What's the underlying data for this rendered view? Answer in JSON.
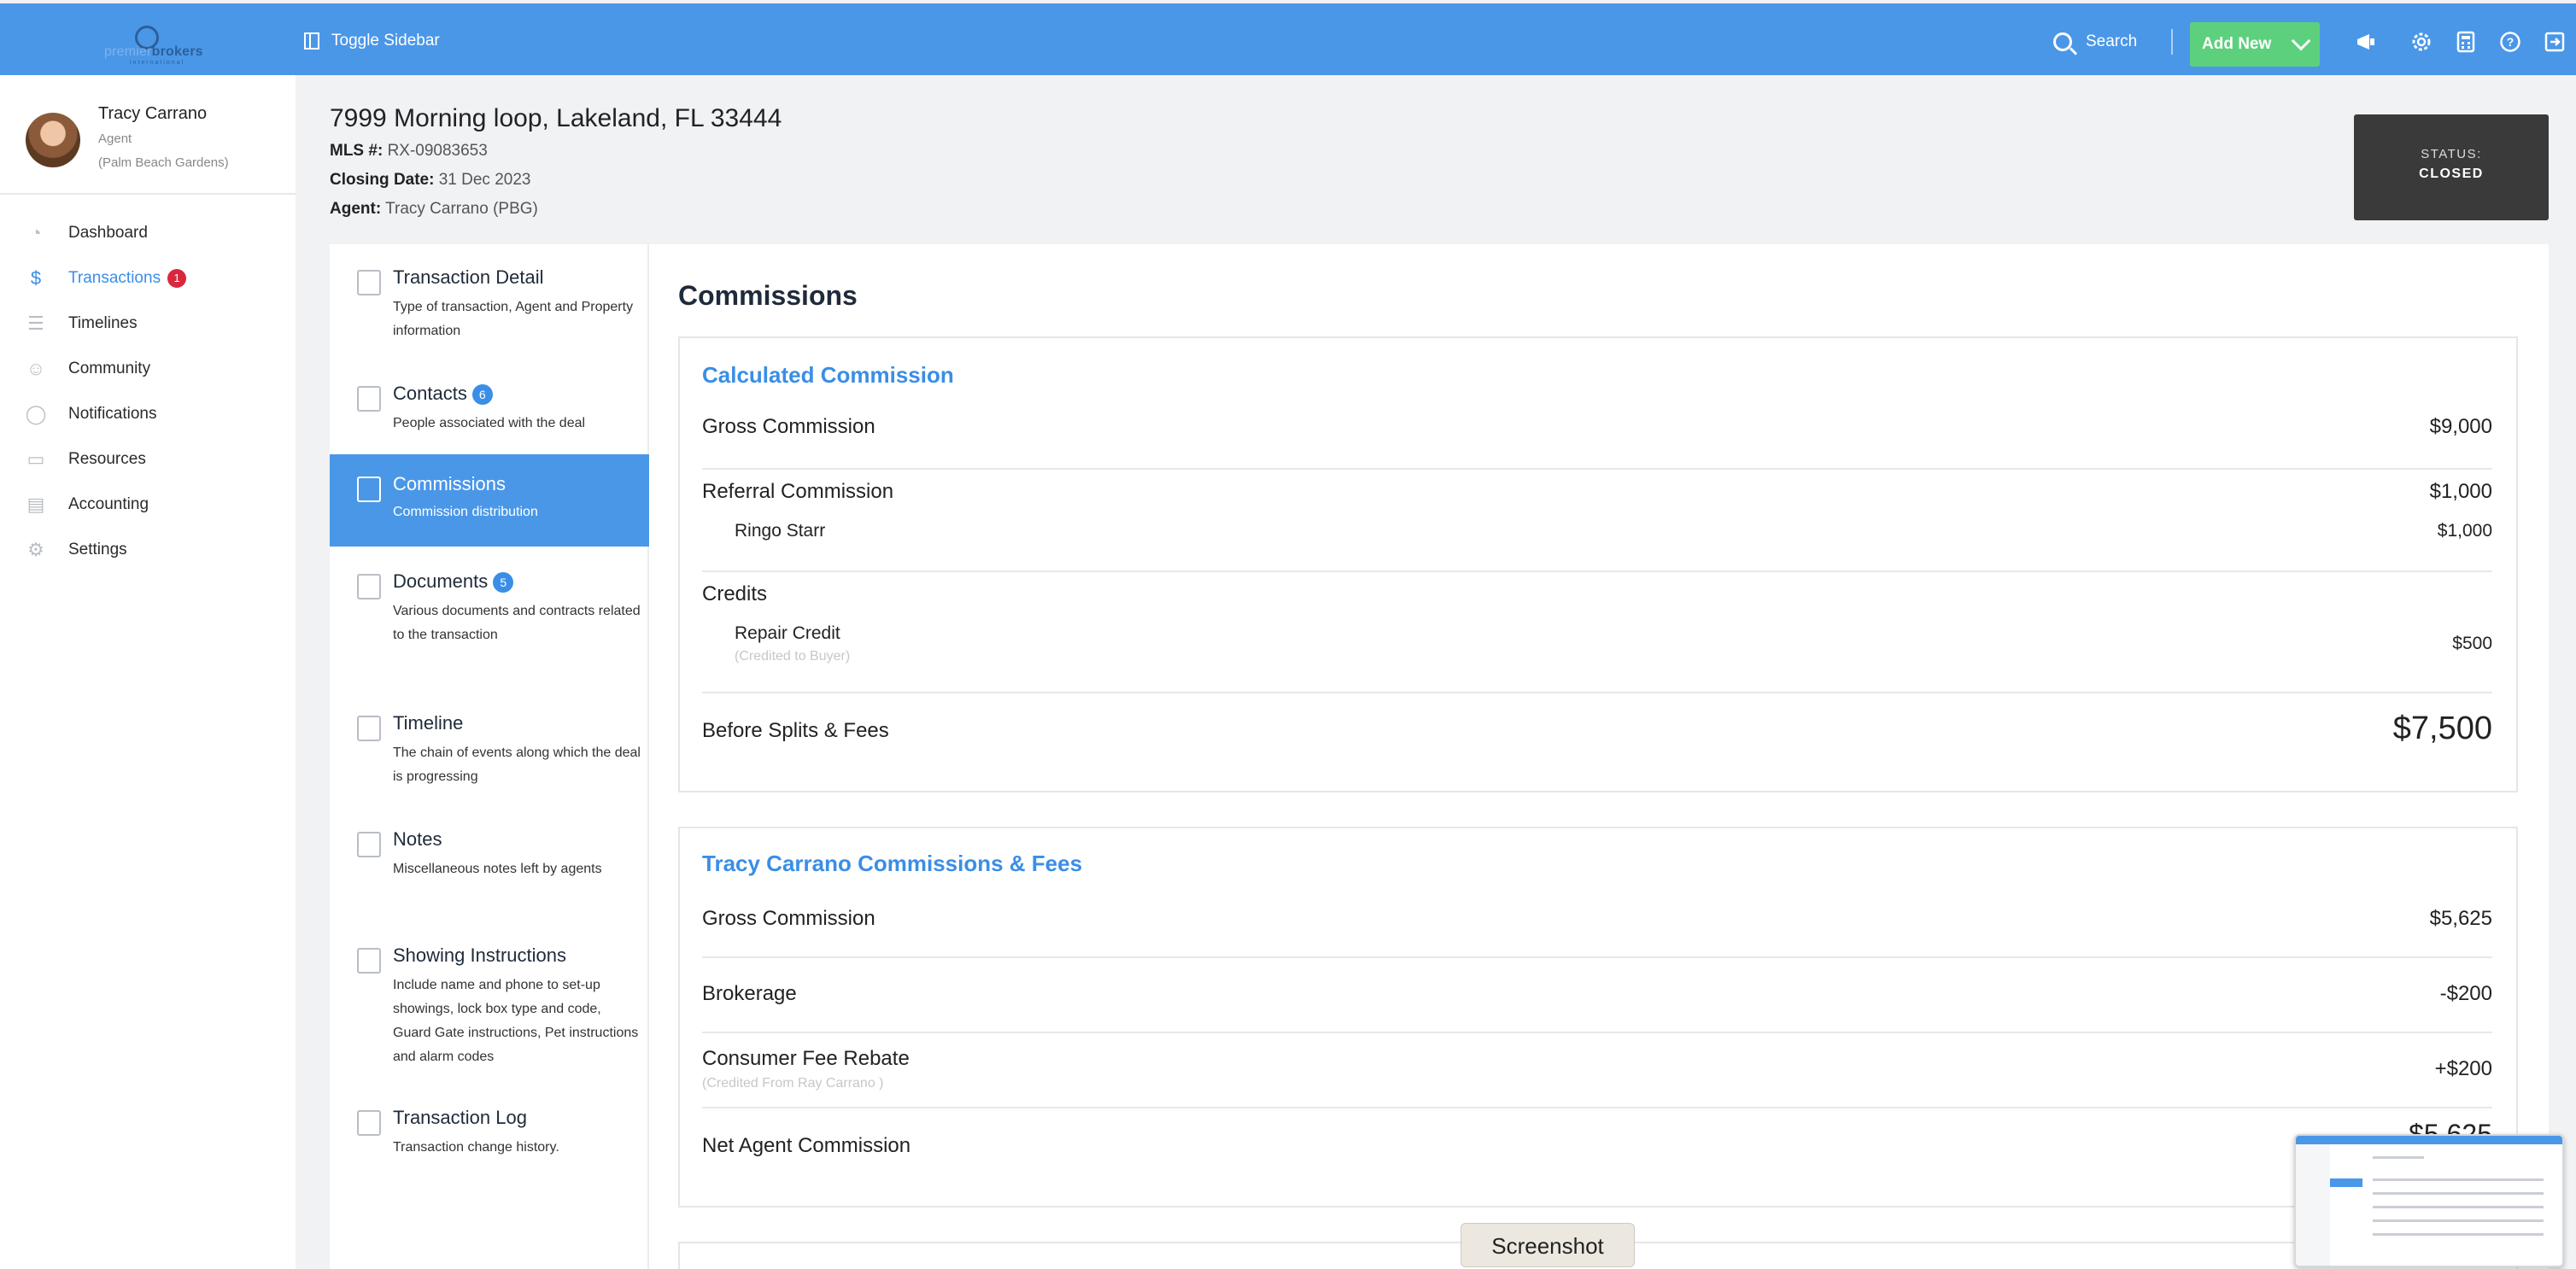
{
  "topbar": {
    "logo_text_prefix": "premier",
    "logo_text_main": "brokers",
    "logo_sub": "international",
    "toggle_sidebar": "Toggle Sidebar",
    "search": "Search",
    "add_new": "Add New",
    "icons": [
      "megaphone-icon",
      "gear-icon",
      "calculator-icon",
      "help-icon",
      "logout-icon"
    ]
  },
  "profile": {
    "name": "Tracy Carrano",
    "role": "Agent",
    "office": "(Palm Beach Gardens)"
  },
  "nav": [
    {
      "label": "Dashboard",
      "icon": "dashboard-icon"
    },
    {
      "label": "Transactions",
      "icon": "dollar-icon",
      "badge": "1",
      "active": true
    },
    {
      "label": "Timelines",
      "icon": "timeline-icon"
    },
    {
      "label": "Community",
      "icon": "community-icon"
    },
    {
      "label": "Notifications",
      "icon": "chat-bubble-icon"
    },
    {
      "label": "Resources",
      "icon": "folder-icon"
    },
    {
      "label": "Accounting",
      "icon": "accounting-icon"
    },
    {
      "label": "Settings",
      "icon": "gear-icon"
    }
  ],
  "header": {
    "address": "7999 Morning loop, Lakeland, FL 33444",
    "mls_label": "MLS #:",
    "mls_value": "RX-09083653",
    "closing_label": "Closing Date:",
    "closing_value": "31 Dec 2023",
    "agent_label": "Agent:",
    "agent_value": "Tracy Carrano (PBG)",
    "status_label": "STATUS:",
    "status_value": "CLOSED"
  },
  "tabs": [
    {
      "title": "Transaction Detail",
      "desc": "Type of transaction, Agent and Property information"
    },
    {
      "title": "Contacts",
      "badge": "6",
      "desc": "People associated with the deal"
    },
    {
      "title": "Commissions",
      "desc": "Commission distribution",
      "active": true
    },
    {
      "title": "Documents",
      "badge": "5",
      "desc": "Various documents and contracts related to the transaction"
    },
    {
      "title": "Timeline",
      "desc": "The chain of events along which the deal is progressing"
    },
    {
      "title": "Notes",
      "desc": "Miscellaneous notes left by agents"
    },
    {
      "title": "Showing Instructions",
      "desc": "Include name and phone to set-up showings, lock box type and code, Guard Gate instructions, Pet instructions and alarm codes"
    },
    {
      "title": "Transaction Log",
      "desc": "Transaction change history."
    }
  ],
  "commissions": {
    "title": "Commissions",
    "calculated": {
      "heading": "Calculated Commission",
      "gross_label": "Gross Commission",
      "gross_value": "$9,000",
      "referral_label": "Referral Commission",
      "referral_value": "$1,000",
      "referral_person": "Ringo Starr",
      "referral_person_value": "$1,000",
      "credits_label": "Credits",
      "repair_label": "Repair Credit",
      "repair_note": "(Credited to Buyer)",
      "repair_value": "$500",
      "before_label": "Before Splits & Fees",
      "before_value": "$7,500"
    },
    "agent": {
      "heading": "Tracy Carrano Commissions & Fees",
      "gross_label": "Gross Commission",
      "gross_value": "$5,625",
      "brokerage_label": "Brokerage",
      "brokerage_value": "-$200",
      "rebate_label": "Consumer Fee Rebate",
      "rebate_note": "(Credited From Ray Carrano )",
      "rebate_value": "+$200",
      "net_label": "Net Agent Commission",
      "net_value": "$5,625"
    }
  },
  "overlay": {
    "screenshot_label": "Screenshot"
  }
}
